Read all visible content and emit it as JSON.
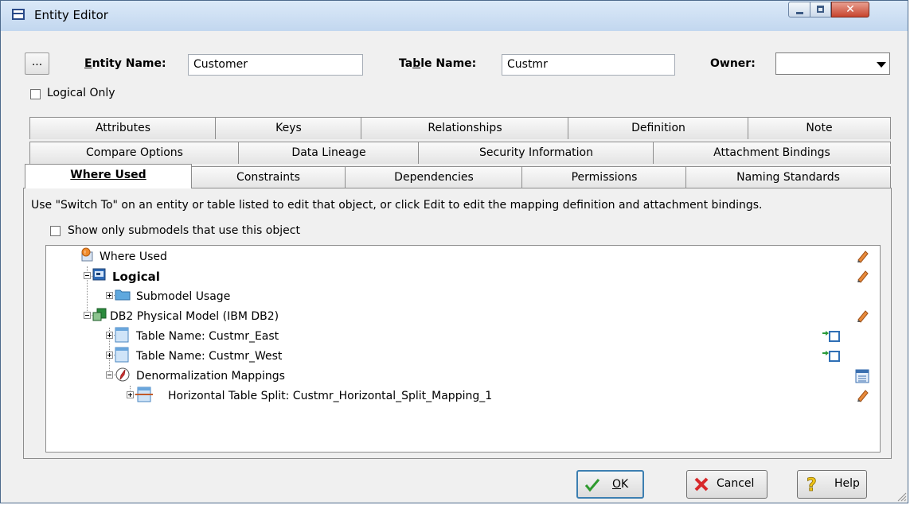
{
  "window": {
    "title": "Entity Editor"
  },
  "header": {
    "ellipsis_label": "...",
    "entity_name_label": "Entity Name:",
    "entity_name_value": "Customer",
    "table_name_label": "Table Name:",
    "table_name_value": "Custmr",
    "owner_label": "Owner:",
    "owner_value": "",
    "logical_only_label": "Logical Only",
    "logical_only_checked": false
  },
  "tabs": {
    "row1": [
      "Attributes",
      "Keys",
      "Relationships",
      "Definition",
      "Note"
    ],
    "row2": [
      "Compare Options",
      "Data Lineage",
      "Security Information",
      "Attachment Bindings"
    ],
    "row3": [
      "Where Used",
      "Constraints",
      "Dependencies",
      "Permissions",
      "Naming Standards"
    ],
    "active": "Where Used"
  },
  "where_used": {
    "instructions": "Use \"Switch To\" on an entity or table listed to edit that object, or click Edit to edit the mapping definition and attachment bindings.",
    "show_only_label": "Show only submodels that use this object",
    "show_only_checked": false,
    "tree": [
      {
        "label": "Where Used",
        "icon": "where-used-icon",
        "action": "edit-pencil-icon"
      },
      {
        "label": "Logical",
        "icon": "logical-model-icon",
        "action": "edit-pencil-icon"
      },
      {
        "label": "Submodel Usage",
        "icon": "folder-icon",
        "action": ""
      },
      {
        "label": "DB2 Physical Model (IBM DB2)",
        "icon": "physical-model-icon",
        "action": "edit-pencil-icon"
      },
      {
        "label": "Table Name: Custmr_East",
        "icon": "table-icon",
        "action": "switch-to-icon"
      },
      {
        "label": "Table Name: Custmr_West",
        "icon": "table-icon",
        "action": "switch-to-icon"
      },
      {
        "label": "Denormalization Mappings",
        "icon": "denormalization-icon",
        "action": "list-icon"
      },
      {
        "label": "Horizontal Table Split: Custmr_Horizontal_Split_Mapping_1",
        "icon": "table-split-icon",
        "action": "edit-pencil-icon"
      }
    ]
  },
  "footer": {
    "ok_label": "OK",
    "cancel_label": "Cancel",
    "help_label": "Help"
  },
  "colors": {
    "title_gradient_top": "#dbe9f8",
    "close_red": "#c7442e",
    "ok_border": "#3c7fb1",
    "check_green": "#2e9a2e"
  }
}
